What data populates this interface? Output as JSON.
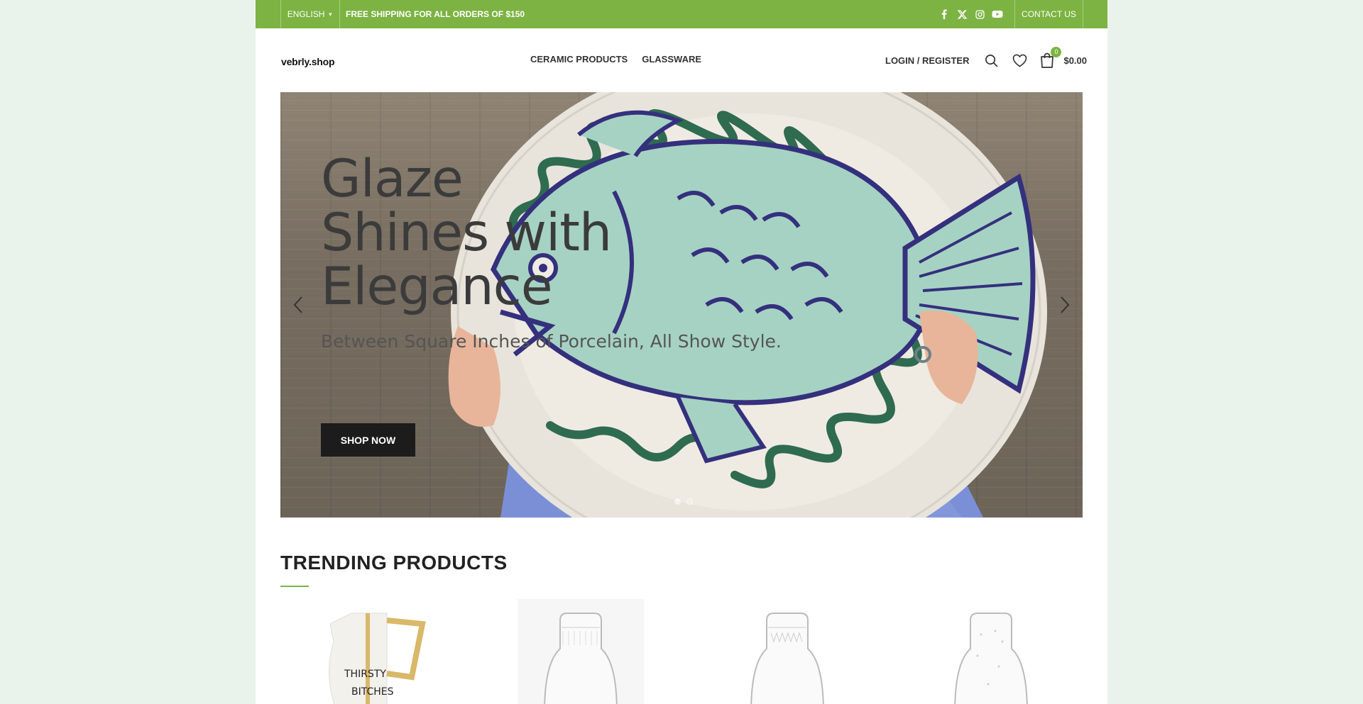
{
  "topbar": {
    "language": "ENGLISH",
    "promo": "FREE SHIPPING FOR ALL ORDERS OF $150",
    "social_icons": [
      "facebook-icon",
      "x-twitter-icon",
      "instagram-icon",
      "youtube-icon"
    ],
    "contact": "CONTACT US",
    "bg_color": "#7cb342"
  },
  "header": {
    "logo": "vebrly.shop",
    "nav": [
      "CERAMIC PRODUCTS",
      "GLASSWARE"
    ],
    "login": "LOGIN / REGISTER",
    "cart_count": "0",
    "cart_total": "$0.00"
  },
  "hero": {
    "title": "Glaze Shines with Elegance",
    "subtitle": "Between Square Inches of Porcelain, All Show Style.",
    "button": "SHOP NOW",
    "slides": 2,
    "active_slide": 1
  },
  "trending": {
    "title": "TRENDING PRODUCTS",
    "products": [
      {
        "name": "thirsty-jug",
        "image_text": "THIRSTY BITCHES"
      },
      {
        "name": "glass-carafe-1"
      },
      {
        "name": "glass-carafe-2"
      },
      {
        "name": "glass-carafe-3"
      }
    ]
  },
  "colors": {
    "accent": "#7cb342",
    "button_dark": "#1c1c1c",
    "page_bg": "#eaf2ec"
  }
}
